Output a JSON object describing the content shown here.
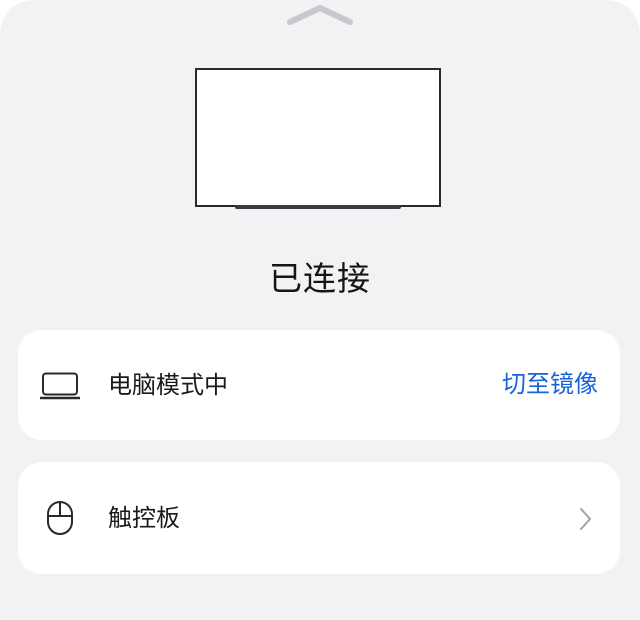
{
  "header": {
    "handle_icon": "chevron-up-icon"
  },
  "display": {
    "icon": "tv-icon"
  },
  "status": {
    "title": "已连接"
  },
  "mode_card": {
    "icon": "laptop-icon",
    "label": "电脑模式中",
    "action_label": "切至镜像",
    "action_color": "#1b63d9"
  },
  "touchpad_card": {
    "icon": "mouse-icon",
    "label": "触控板",
    "trailing_icon": "chevron-right-icon"
  },
  "colors": {
    "sheet_background": "#f2f2f4",
    "card_background": "#ffffff",
    "text_primary": "#151515",
    "icon_gray": "#8e8e93"
  }
}
